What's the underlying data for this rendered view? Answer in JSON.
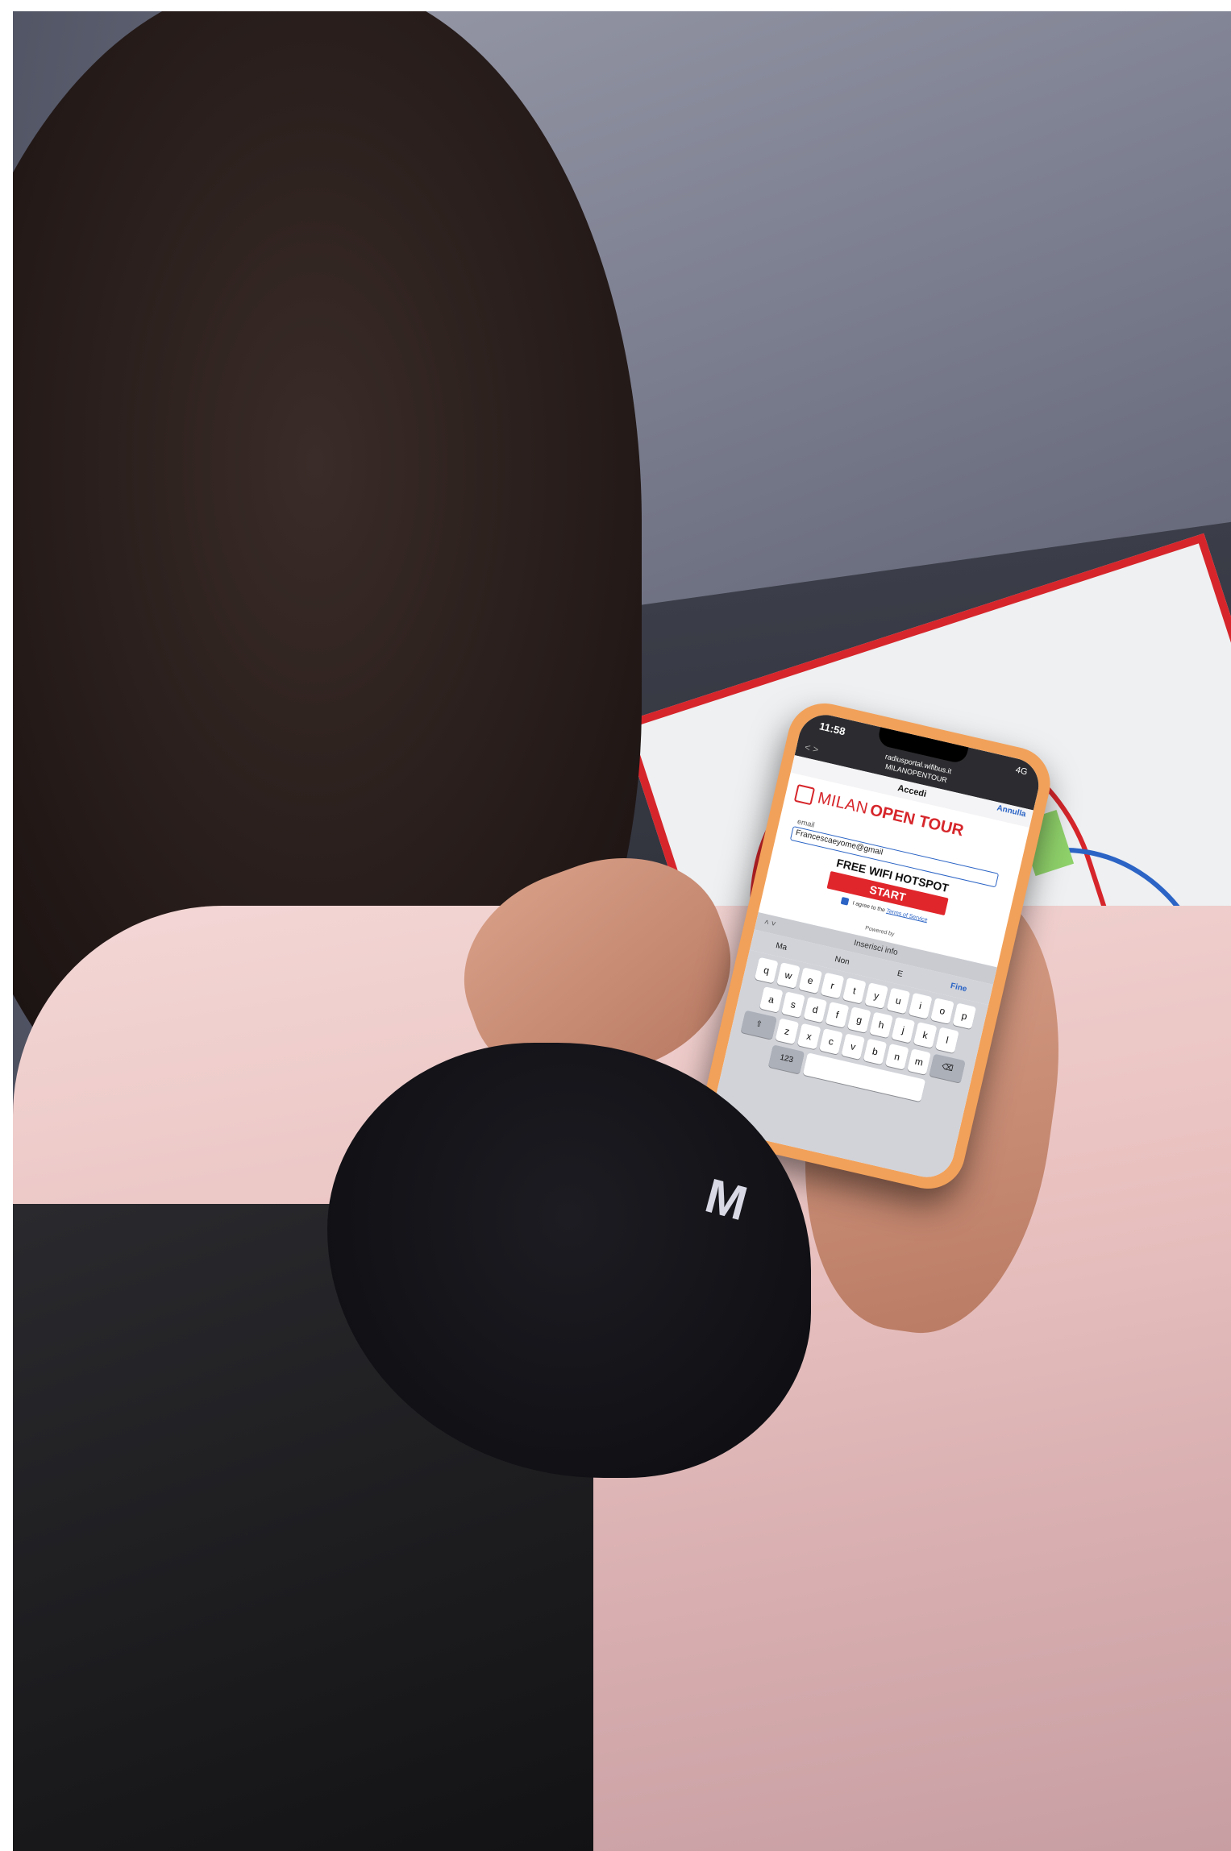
{
  "phone": {
    "time": "11:58",
    "signal": "4G",
    "url": "radiusportal.wifibus.it",
    "page_title": "MILANOPENTOUR",
    "nav_arrows": "< >",
    "sheet_title": "Accedi",
    "cancel_label": "Annulla",
    "logo_part1": "MILAN",
    "logo_part2": "OPEN TOUR",
    "email_label": "email",
    "email_value": "Francescaeyome@gmail",
    "hotspot_text": "FREE WIFI HOTSPOT",
    "start_label": "START",
    "terms_prefix": "I agree to the",
    "terms_link": "Terms of Service",
    "powered_by": "Powered by",
    "kb_bar_title": "Inserisci info",
    "suggestions": [
      "Ma",
      "Non",
      "E"
    ],
    "done_label": "Fine",
    "keys_row1": [
      "q",
      "w",
      "e",
      "r",
      "t",
      "y",
      "u",
      "i",
      "o",
      "p"
    ],
    "keys_row2": [
      "a",
      "s",
      "d",
      "f",
      "g",
      "h",
      "j",
      "k",
      "l"
    ],
    "keys_row3": [
      "z",
      "x",
      "c",
      "v",
      "b",
      "n",
      "m"
    ],
    "key_123": "123"
  },
  "glove_text": "M",
  "colors": {
    "brand_red": "#d6262b",
    "link_blue": "#2b64c5",
    "phone_case": "#f2a15a"
  }
}
